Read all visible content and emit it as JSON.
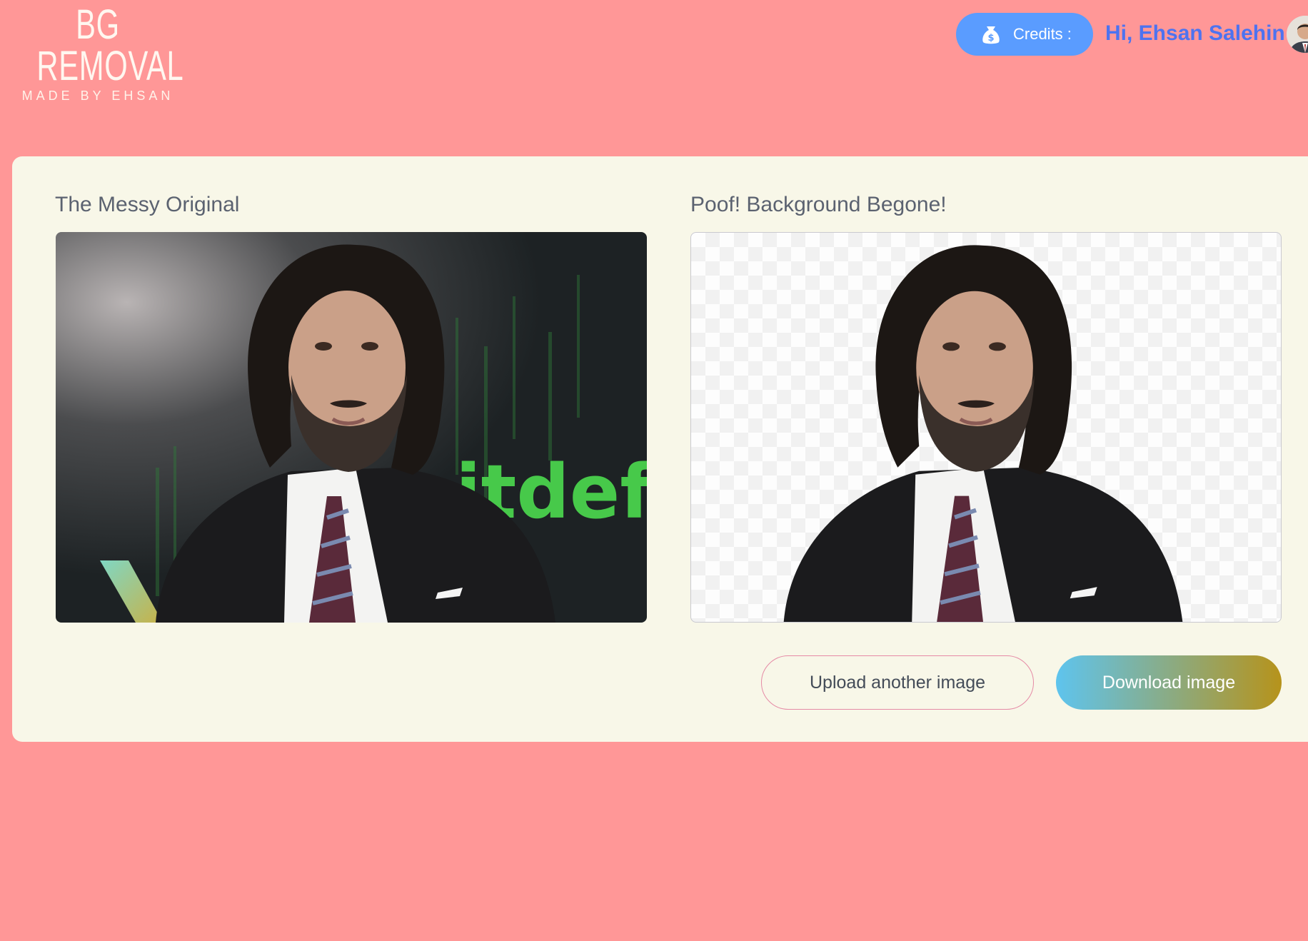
{
  "header": {
    "logo_title": "BG REMOVAL",
    "logo_subtitle": "MADE BY EHSAN",
    "credits_label": "Credits :",
    "credits_icon": "money-bag-icon",
    "greeting": "Hi, Ehsan Salehin"
  },
  "colors": {
    "page_background": "#ff9797",
    "card_background": "#f8f7e8",
    "credits_button": "#5a9cff",
    "greeting_text": "#4d73f0",
    "download_gradient_start": "#5ec4ee",
    "download_gradient_end": "#b6931b",
    "upload_border": "#e58aa5"
  },
  "main": {
    "original_title": "The Messy Original",
    "result_title": "Poof! Background Begone!",
    "original_image_sign_text": "itdefe",
    "upload_button": "Upload another image",
    "download_button": "Download image"
  }
}
